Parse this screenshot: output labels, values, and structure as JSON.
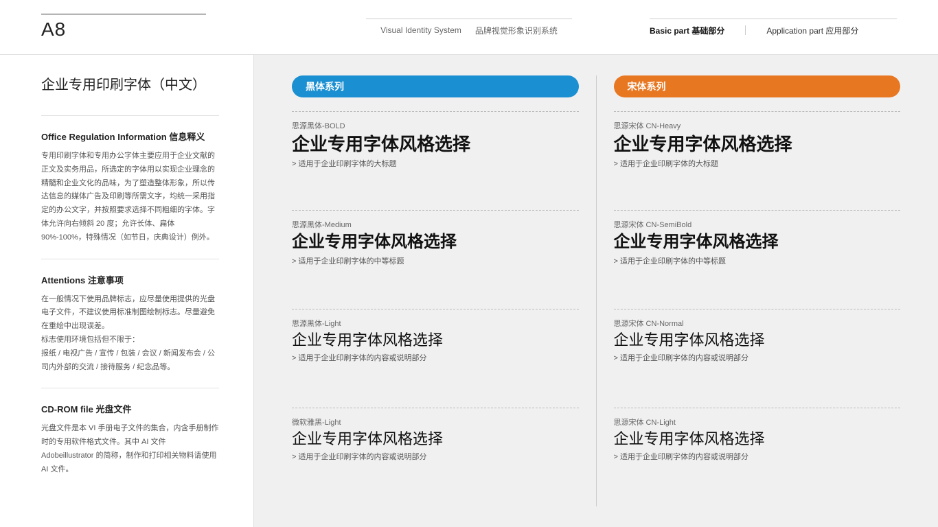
{
  "header": {
    "page_number": "A8",
    "vis_en": "Visual Identity System",
    "vis_cn": "品牌视觉形象识别系统",
    "nav": [
      {
        "label": "Basic part  基础部分",
        "active": true
      },
      {
        "label": "Application part  应用部分",
        "active": false
      }
    ]
  },
  "sidebar": {
    "title": "企业专用印刷字体（中文）",
    "sections": [
      {
        "title": "Office Regulation Information 信息释义",
        "text": "专用印刷字体和专用办公字体主要应用于企业文献的正文及实务用品，所选定的字体用以实现企业理念的精髓和企业文化的品味，为了塑造整体形象，所以传达信息的媒体广告及印刷等所需文字，均统一采用指定的办公文字，并按照要求选择不同粗细的字体。字体允许向右倾斜 20 度；允许长体、扁体 90%-100%，特殊情况（如节日，庆典设计）例外。"
      },
      {
        "title": "Attentions 注意事项",
        "text": "在一般情况下使用品牌标志，应尽量使用提供的光盘电子文件，不建议使用标准制图绘制标志。尽量避免在重绘中出现误差。\n标志使用环境包括但不限于：\n报纸 / 电视广告 / 宣传 / 包装 / 会议 / 新闻发布会 / 公司内外部的交流 / 接待服务 / 纪念品等。"
      },
      {
        "title": "CD-ROM file 光盘文件",
        "text": "光盘文件是本 VI 手册电子文件的集合，内含手册制作时的专用软件格式文件。其中 AI 文件 Adobeillustrator 的简称，制作和打印相关物料请使用 AI 文件。"
      }
    ]
  },
  "content": {
    "columns": [
      {
        "cat_label": "黑体系列",
        "cat_color": "blue",
        "fonts": [
          {
            "name": "思源黑体-BOLD",
            "demo": "企业专用字体风格选择",
            "weight": "bold",
            "desc": "适用于企业印刷字体的大标题"
          },
          {
            "name": "思源黑体-Medium",
            "demo": "企业专用字体风格选择",
            "weight": "medium",
            "desc": "适用于企业印刷字体的中等标题"
          },
          {
            "name": "思源黑体-Light",
            "demo": "企业专用字体风格选择",
            "weight": "light",
            "desc": "适用于企业印刷字体的内容或说明部分"
          },
          {
            "name": "微软雅黑-Light",
            "demo": "企业专用字体风格选择",
            "weight": "light",
            "desc": "适用于企业印刷字体的内容或说明部分"
          }
        ]
      },
      {
        "cat_label": "宋体系列",
        "cat_color": "orange",
        "fonts": [
          {
            "name": "思源宋体 CN-Heavy",
            "demo": "企业专用字体风格选择",
            "weight": "bold",
            "desc": "适用于企业印刷字体的大标题"
          },
          {
            "name": "思源宋体 CN-SemiBold",
            "demo": "企业专用字体风格选择",
            "weight": "medium",
            "desc": "适用于企业印刷字体的中等标题"
          },
          {
            "name": "思源宋体 CN-Normal",
            "demo": "企业专用字体风格选择",
            "weight": "light",
            "desc": "适用于企业印刷字体的内容或说明部分"
          },
          {
            "name": "思源宋体 CN-Light",
            "demo": "企业专用字体风格选择",
            "weight": "light",
            "desc": "适用于企业印刷字体的内容或说明部分"
          }
        ]
      }
    ]
  }
}
